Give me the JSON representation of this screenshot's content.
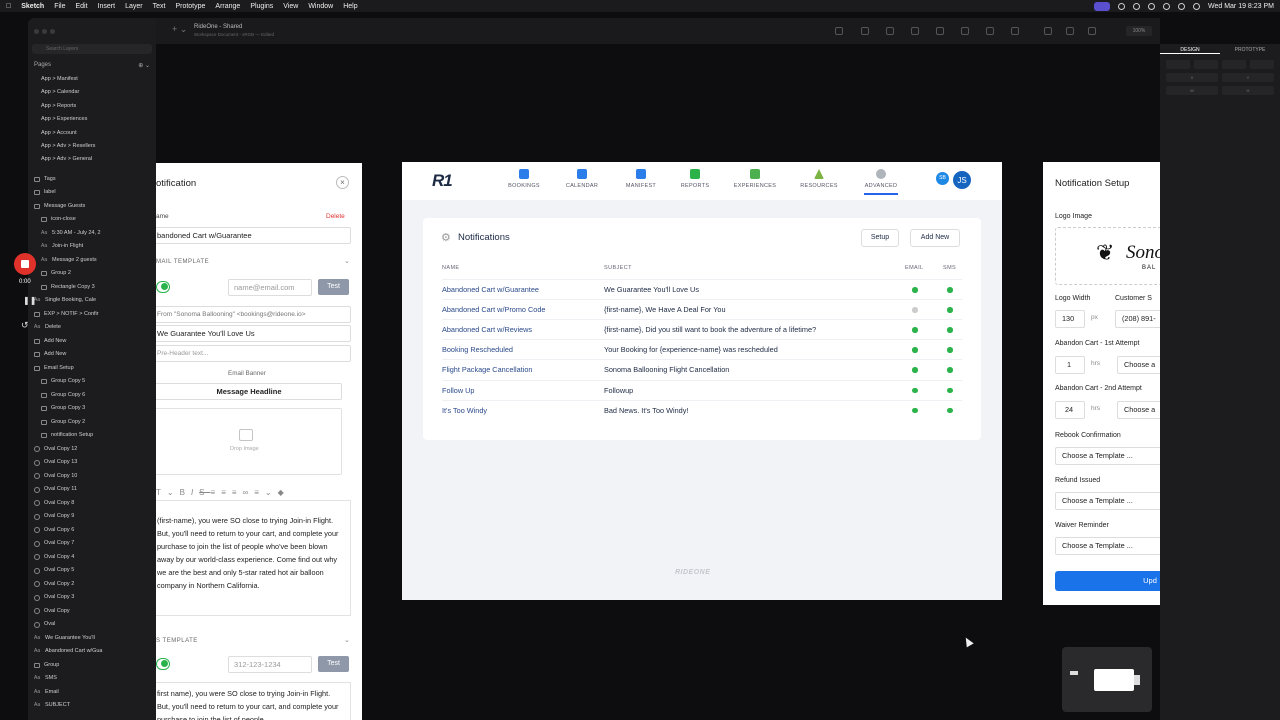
{
  "menubar": {
    "app": "Sketch",
    "items": [
      "File",
      "Edit",
      "Insert",
      "Layer",
      "Text",
      "Prototype",
      "Arrange",
      "Plugins",
      "View",
      "Window",
      "Help"
    ],
    "clock": "Wed Mar 19  8:23 PM"
  },
  "layers": {
    "search_placeholder": "Search Layers",
    "pages_label": "Pages",
    "pages": [
      "App > Manifest",
      "App > Calendar",
      "App > Reports",
      "App > Experiences",
      "App > Account",
      "App > Adv > Resellers",
      "App > Adv > General"
    ],
    "items": [
      {
        "label": "Tags",
        "kind": "group",
        "indent": 0
      },
      {
        "label": "label",
        "kind": "group",
        "indent": 0
      },
      {
        "label": "Message Guests",
        "kind": "group",
        "indent": 0
      },
      {
        "label": "icon-close",
        "kind": "group",
        "indent": 1
      },
      {
        "label": "5:30 AM - July 24, 2",
        "kind": "text",
        "indent": 1
      },
      {
        "label": "Join-in Flight",
        "kind": "text",
        "indent": 1
      },
      {
        "label": "Message 2 guests",
        "kind": "text",
        "indent": 1
      },
      {
        "label": "Group 2",
        "kind": "group",
        "indent": 1
      },
      {
        "label": "Rectangle Copy 3",
        "kind": "rect",
        "indent": 1
      },
      {
        "label": "Single Booking, Cale",
        "kind": "text",
        "indent": 0
      },
      {
        "label": "EXP > NOTIF > Confir",
        "kind": "group",
        "indent": 0
      },
      {
        "label": "Delete",
        "kind": "text",
        "indent": 0
      },
      {
        "label": "Add New",
        "kind": "group",
        "indent": 0
      },
      {
        "label": "Add New",
        "kind": "group",
        "indent": 0
      },
      {
        "label": "Email Setup",
        "kind": "group",
        "indent": 0
      },
      {
        "label": "Group Copy 5",
        "kind": "group",
        "indent": 1
      },
      {
        "label": "Group Copy 6",
        "kind": "group",
        "indent": 1
      },
      {
        "label": "Group Copy 3",
        "kind": "group",
        "indent": 1
      },
      {
        "label": "Group Copy 2",
        "kind": "group",
        "indent": 1
      },
      {
        "label": "notification Setup",
        "kind": "group",
        "indent": 1
      },
      {
        "label": "Oval Copy 12",
        "kind": "oval",
        "indent": 0
      },
      {
        "label": "Oval Copy 13",
        "kind": "oval",
        "indent": 0
      },
      {
        "label": "Oval Copy 10",
        "kind": "oval",
        "indent": 0
      },
      {
        "label": "Oval Copy 11",
        "kind": "oval",
        "indent": 0
      },
      {
        "label": "Oval Copy 8",
        "kind": "oval",
        "indent": 0
      },
      {
        "label": "Oval Copy 9",
        "kind": "oval",
        "indent": 0
      },
      {
        "label": "Oval Copy 6",
        "kind": "oval",
        "indent": 0
      },
      {
        "label": "Oval Copy 7",
        "kind": "oval",
        "indent": 0
      },
      {
        "label": "Oval Copy 4",
        "kind": "oval",
        "indent": 0
      },
      {
        "label": "Oval Copy 5",
        "kind": "oval",
        "indent": 0
      },
      {
        "label": "Oval Copy 2",
        "kind": "oval",
        "indent": 0
      },
      {
        "label": "Oval Copy 3",
        "kind": "oval",
        "indent": 0
      },
      {
        "label": "Oval Copy",
        "kind": "oval",
        "indent": 0
      },
      {
        "label": "Oval",
        "kind": "oval",
        "indent": 0
      },
      {
        "label": "We Guarantee You'll",
        "kind": "text",
        "indent": 0
      },
      {
        "label": "Abandoned Cart w/Gua",
        "kind": "text",
        "indent": 0
      },
      {
        "label": "Group",
        "kind": "group",
        "indent": 0
      },
      {
        "label": "SMS",
        "kind": "text",
        "indent": 0
      },
      {
        "label": "Email",
        "kind": "text",
        "indent": 0
      },
      {
        "label": "SUBJECT",
        "kind": "text",
        "indent": 0
      }
    ]
  },
  "recorder": {
    "time": "0:00"
  },
  "toolbar": {
    "doc_title": "RideOne - Shared",
    "doc_subtitle": "Workspace Document - sRGB — Edited",
    "zoom": "100%"
  },
  "inspector": {
    "tab_design": "DESIGN",
    "tab_prototype": "PROTOTYPE",
    "x": "X",
    "y": "Y",
    "w": "W",
    "h": "H"
  },
  "editor": {
    "title": "otification",
    "close": "×",
    "name_label": "ame",
    "delete_label": "Delete",
    "name_value": "bandoned Cart w/Guarantee",
    "email_section": "MAIL TEMPLATE",
    "email_placeholder": "name@email.com",
    "test_label": "Test",
    "from_value": "From \"Sonoma Ballooning\" <bookings@rideone.io>",
    "subject_value": "We Guarantee You'll Love Us",
    "preheader_placeholder": "Pre-Header text...",
    "banner_label": "Email Banner",
    "headline_value": "Message Headline",
    "drop_image": "Drop Image",
    "email_body": "(first-name), you were SO close to trying Join-in Flight. But, you'll need to return to your cart, and complete your purchase to join the list of people who've been blown away by our world-class experience. Come find out why we are the best and only 5-star rated hot air balloon company in Northern California.",
    "sms_section": "S TEMPLATE",
    "phone_placeholder": "312-123-1234",
    "sms_body": "first name), you were SO close to trying Join-in Flight. But, you'll need to return to your cart, and complete your purchase to join the list of people"
  },
  "app": {
    "logo": "R1",
    "nav": [
      "BOOKINGS",
      "CALENDAR",
      "MANIFEST",
      "REPORTS",
      "EXPERIENCES",
      "RESOURCES",
      "ADVANCED"
    ],
    "avatar_small": "SB",
    "avatar_large": "JS",
    "card_title": "Notifications",
    "setup_btn": "Setup",
    "add_new_btn": "Add New",
    "columns": {
      "name": "NAME",
      "subject": "SUBJECT",
      "email": "EMAIL",
      "sms": "SMS"
    },
    "rows": [
      {
        "name": "Abandoned Cart w/Guarantee",
        "subject": "We Guarantee You'll Love Us",
        "email": true,
        "sms": true
      },
      {
        "name": "Abandoned Cart w/Promo Code",
        "subject": "{first-name}, We Have A Deal For You",
        "email": false,
        "sms": true
      },
      {
        "name": "Abandoned Cart w/Reviews",
        "subject": "{first-name}, Did you still want to book the adventure of a lifetime?",
        "email": true,
        "sms": true
      },
      {
        "name": "Booking Rescheduled",
        "subject": "Your Booking for {experience-name} was rescheduled",
        "email": true,
        "sms": true
      },
      {
        "name": "Flight Package Cancellation",
        "subject": "Sonoma Ballooning Flight Cancellation",
        "email": true,
        "sms": true
      },
      {
        "name": "Follow Up",
        "subject": "Followup",
        "email": true,
        "sms": true
      },
      {
        "name": "It's Too Windy",
        "subject": "Bad News. It's Too Windy!",
        "email": true,
        "sms": true
      }
    ],
    "footer": "RIDEONE"
  },
  "setup": {
    "title": "Notification Setup",
    "logo_image": "Logo Image",
    "logo_text": "Sono",
    "logo_text2": "BAL",
    "logo_width_label": "Logo Width",
    "logo_width": "130",
    "px": "px",
    "customer_label": "Customer S",
    "customer_value": "(208) 891-",
    "ac1_label": "Abandon Cart - 1st Attempt",
    "ac1_value": "1",
    "hrs": "hrs",
    "choose_short": "Choose a",
    "ac2_label": "Abandon Cart - 2nd Attempt",
    "ac2_value": "24",
    "rebook_label": "Rebook Confirmation",
    "choose_template": "Choose a Template ...",
    "refund_label": "Refund Issued",
    "waiver_label": "Waiver Reminder",
    "update_btn": "Upd"
  },
  "colors": {
    "accent": "#2563eb",
    "green": "#2bb34a",
    "record": "#e0322b",
    "update": "#1a73e8"
  }
}
